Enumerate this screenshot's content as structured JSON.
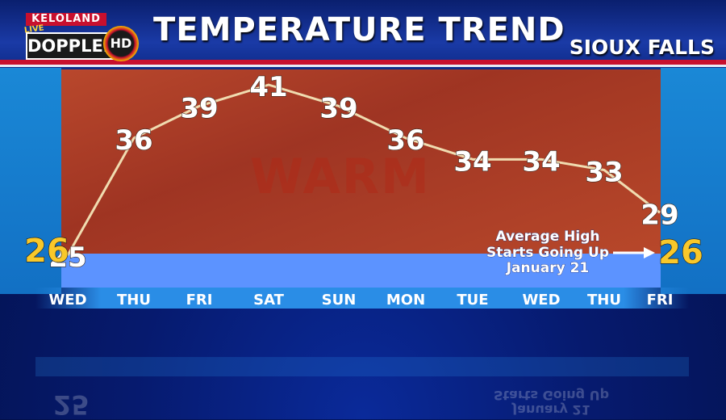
{
  "header": {
    "logo": {
      "station": "KELOLAND",
      "live": "LIVE",
      "brand": "DOPPLER",
      "hd": "HD"
    },
    "title": "TEMPERATURE TREND",
    "location": "SIOUX FALLS"
  },
  "background_word": "WARM",
  "colors": {
    "header_blue": "#0d2a86",
    "header_red": "#c8102e",
    "warm_panel": "#b5412a",
    "average_band": "#5c93ff",
    "average_value": "#f9c82a",
    "line": "#f0dcb0"
  },
  "chart_data": {
    "type": "line",
    "title": "TEMPERATURE TREND",
    "categories": [
      "WED",
      "THU",
      "FRI",
      "SAT",
      "SUN",
      "MON",
      "TUE",
      "WED",
      "THU",
      "FRI"
    ],
    "series": [
      {
        "values": [
          25,
          36,
          39,
          41,
          39,
          36,
          34,
          34,
          33,
          29
        ]
      }
    ],
    "average_high": {
      "start": 26,
      "end": 26
    },
    "annotation": [
      "Average High",
      "Starts Going Up",
      "January 21"
    ],
    "ylim": [
      24,
      42
    ],
    "grid": false,
    "legend": "none"
  }
}
